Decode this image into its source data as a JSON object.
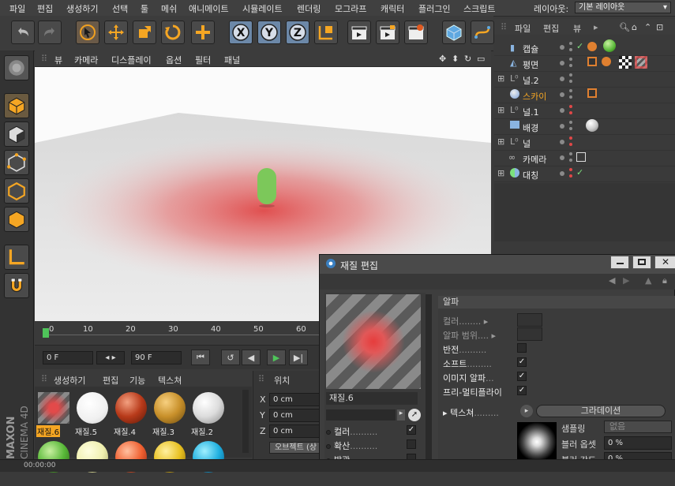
{
  "menu": [
    "파일",
    "편집",
    "생성하기",
    "선택",
    "툴",
    "메쉬",
    "애니메이트",
    "시뮬레이트",
    "렌더링",
    "모그라프",
    "캐릭터",
    "플러그인",
    "스크립트"
  ],
  "layout": {
    "label": "레이아웃:",
    "value": "기본 레이아웃"
  },
  "viewport_menu": [
    "뷰",
    "카메라",
    "디스플레이",
    "옵션",
    "필터",
    "패널"
  ],
  "timeline": {
    "ticks": [
      "0",
      "10",
      "20",
      "30",
      "40",
      "50",
      "60"
    ],
    "current_frame": "0 F",
    "end_frame": "90 F"
  },
  "material_manager": {
    "menu": [
      "생성하기",
      "편집",
      "기능",
      "텍스쳐"
    ],
    "materials": [
      {
        "label": "재질.6",
        "color": "#d24a4a",
        "selected": true
      },
      {
        "label": "재질.5",
        "color": "#ffffff"
      },
      {
        "label": "재질.4",
        "color": "#b83a1a"
      },
      {
        "label": "재질.3",
        "color": "#c8902a"
      },
      {
        "label": "재질.2",
        "color": "#dcdcdc"
      }
    ]
  },
  "coordinates": {
    "title": "위치",
    "x": "0 cm",
    "y": "0 cm",
    "z": "0 cm",
    "button": "오브젝트 (상"
  },
  "object_manager": {
    "menu": [
      "파일",
      "편집",
      "뷰"
    ],
    "objects": [
      {
        "name": "캡슐"
      },
      {
        "name": "평면"
      },
      {
        "name": "널.2"
      },
      {
        "name": "스카이",
        "highlight": true
      },
      {
        "name": "널.1"
      },
      {
        "name": "배경"
      },
      {
        "name": "널"
      },
      {
        "name": "카메라"
      },
      {
        "name": "대칭"
      }
    ]
  },
  "material_editor": {
    "title": "재질 편집",
    "material_name": "재질.6",
    "channels": [
      "컬러",
      "확산",
      "발광"
    ],
    "section": "알파",
    "rows": [
      {
        "label": "컬러",
        "dots": "........"
      },
      {
        "label": "알파 범위",
        "dots": "...."
      },
      {
        "label": "반전",
        "dots": "..........",
        "checked": false
      },
      {
        "label": "소프트",
        "dots": ".........",
        "checked": true
      },
      {
        "label": "이미지 알파",
        "dots": "...",
        "checked": true
      },
      {
        "label": "프리-멀티플라이",
        "dots": "",
        "checked": true
      }
    ],
    "texture_label": "텍스쳐",
    "texture_dots": ".........",
    "gradient_button": "그라데이션",
    "sampling_label": "샘플링",
    "sampling_value": "없음",
    "blur_offset_label": "블러 옵셋",
    "blur_offset_value": "0 %",
    "blur_strength_label": "블러 강도",
    "blur_strength_value": "0 %"
  },
  "status": {
    "time": "00:00:00"
  },
  "brand": {
    "maxon": "MAXON",
    "product": "CINEMA 4D"
  }
}
